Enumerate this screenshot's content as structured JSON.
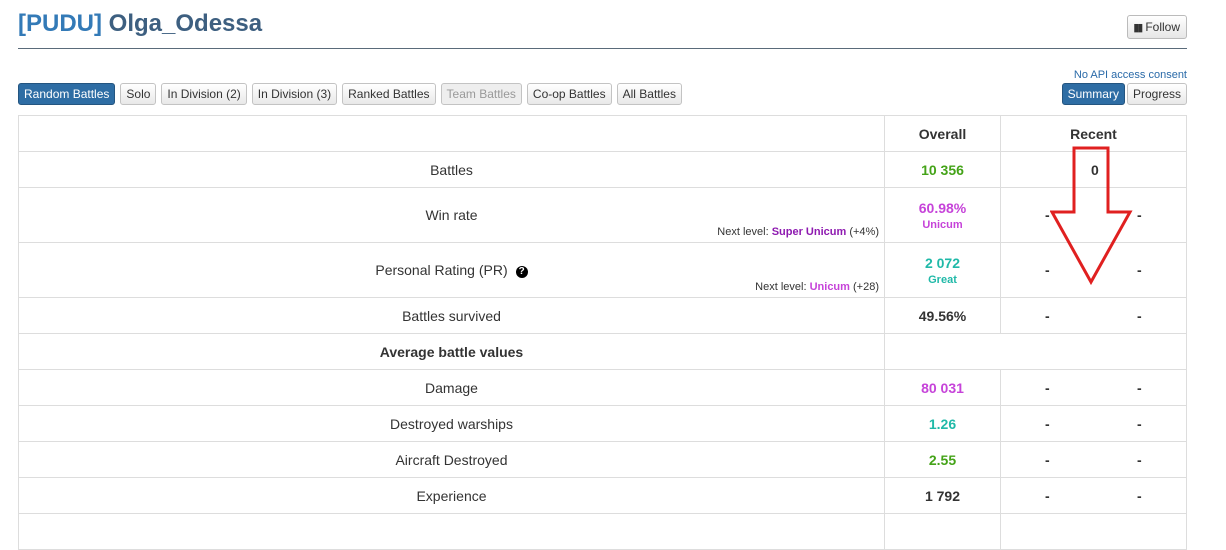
{
  "header": {
    "clan_tag": "[PUDU]",
    "player_name": "Olga_Odessa",
    "follow_label": "Follow"
  },
  "consent_text": "No API access consent",
  "tabs": [
    {
      "label": "Random Battles",
      "state": "active"
    },
    {
      "label": "Solo",
      "state": "normal"
    },
    {
      "label": "In Division (2)",
      "state": "normal"
    },
    {
      "label": "In Division (3)",
      "state": "normal"
    },
    {
      "label": "Ranked Battles",
      "state": "normal"
    },
    {
      "label": "Team Battles",
      "state": "disabled"
    },
    {
      "label": "Co-op Battles",
      "state": "normal"
    },
    {
      "label": "All Battles",
      "state": "normal"
    }
  ],
  "views": [
    {
      "label": "Summary",
      "state": "active"
    },
    {
      "label": "Progress",
      "state": "normal"
    }
  ],
  "table": {
    "col_overall": "Overall",
    "col_recent": "Recent",
    "section_average": "Average battle values",
    "rows": {
      "battles": {
        "label": "Battles",
        "overall": "10 356",
        "recent": "0"
      },
      "winrate": {
        "label": "Win rate",
        "overall": "60.98%",
        "tier": "Unicum",
        "next_prefix": "Next level:",
        "next_level": "Super Unicum",
        "next_delta": "(+4%)",
        "recent_a": "-",
        "recent_b": "-"
      },
      "pr": {
        "label": "Personal Rating (PR)",
        "help_icon": "question-circle-icon",
        "overall": "2 072",
        "tier": "Great",
        "next_prefix": "Next level:",
        "next_level": "Unicum",
        "next_delta": "(+28)",
        "recent_a": "-",
        "recent_b": "-"
      },
      "survived": {
        "label": "Battles survived",
        "overall": "49.56%",
        "recent_a": "-",
        "recent_b": "-"
      },
      "damage": {
        "label": "Damage",
        "overall": "80 031",
        "recent_a": "-",
        "recent_b": "-"
      },
      "warships": {
        "label": "Destroyed warships",
        "overall": "1.26",
        "recent_a": "-",
        "recent_b": "-"
      },
      "aircraft": {
        "label": "Aircraft Destroyed",
        "overall": "2.55",
        "recent_a": "-",
        "recent_b": "-"
      },
      "experience": {
        "label": "Experience",
        "overall": "1 792",
        "recent_a": "-",
        "recent_b": "-"
      }
    }
  },
  "colors": {
    "green": "#44a318",
    "purple": "#c643d9",
    "dark_purple": "#8e1ab0",
    "teal": "#20b9a8",
    "arrow_red": "#e02020"
  }
}
